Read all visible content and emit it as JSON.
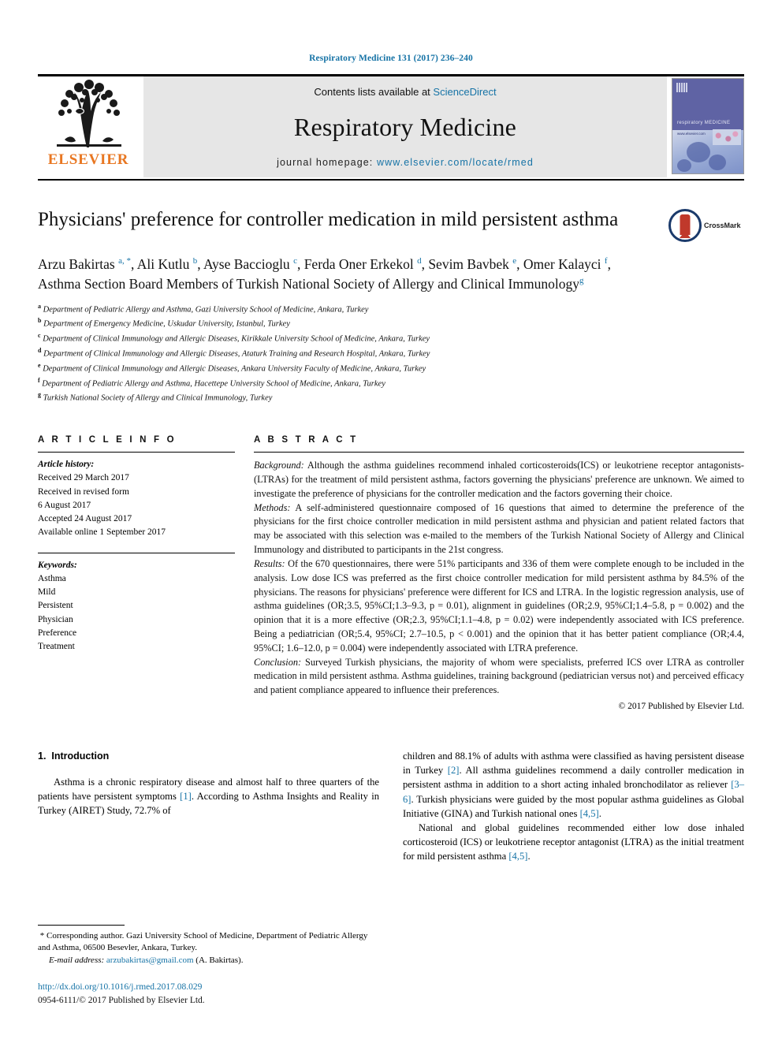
{
  "header": {
    "running_head": "Respiratory Medicine 131 (2017) 236–240",
    "contents_prefix": "Contents lists available at ",
    "contents_link": "ScienceDirect",
    "journal_name": "Respiratory Medicine",
    "homepage_prefix": "journal homepage: ",
    "homepage_url": "www.elsevier.com/locate/rmed",
    "publisher_logo_text": "ELSEVIER",
    "cover_title": "respiratory MEDICINE",
    "cover_url": "www.elsevier.com",
    "link_color": "#1673a6",
    "elsevier_orange": "#e87722"
  },
  "article": {
    "title": "Physicians' preference for controller medication in mild persistent asthma",
    "crossmark_label": "CrossMark",
    "authors_html": "Arzu Bakirtas <sup>a, *</sup>, Ali Kutlu <sup>b</sup>, Ayse Baccioglu <sup>c</sup>, Ferda Oner Erkekol <sup>d</sup>, Sevim Bavbek <sup>e</sup>, Omer Kalayci <sup>f</sup>, Asthma Section Board Members of Turkish National Society of Allergy and Clinical Immunology<sup>g</sup>",
    "affiliations": [
      {
        "marker": "a",
        "text": "Department of Pediatric Allergy and Asthma, Gazi University School of Medicine, Ankara, Turkey"
      },
      {
        "marker": "b",
        "text": "Department of Emergency Medicine, Uskudar University, Istanbul, Turkey"
      },
      {
        "marker": "c",
        "text": "Department of Clinical Immunology and Allergic Diseases, Kirikkale University School of Medicine, Ankara, Turkey"
      },
      {
        "marker": "d",
        "text": "Department of Clinical Immunology and Allergic Diseases, Ataturk Training and Research Hospital, Ankara, Turkey"
      },
      {
        "marker": "e",
        "text": "Department of Clinical Immunology and Allergic Diseases, Ankara University Faculty of Medicine, Ankara, Turkey"
      },
      {
        "marker": "f",
        "text": "Department of Pediatric Allergy and Asthma, Hacettepe University School of Medicine, Ankara, Turkey"
      },
      {
        "marker": "g",
        "text": "Turkish National Society of Allergy and Clinical Immunology, Turkey"
      }
    ]
  },
  "article_info": {
    "heading": "A R T I C L E   I N F O",
    "history_label": "Article history:",
    "history_lines": [
      "Received 29 March 2017",
      "Received in revised form",
      "6 August 2017",
      "Accepted 24 August 2017",
      "Available online 1 September 2017"
    ],
    "keywords_label": "Keywords:",
    "keywords": [
      "Asthma",
      "Mild",
      "Persistent",
      "Physician",
      "Preference",
      "Treatment"
    ]
  },
  "abstract": {
    "heading": "A B S T R A C T",
    "sections": [
      {
        "label": "Background:",
        "text": " Although the asthma guidelines recommend inhaled corticosteroids(ICS) or leukotriene receptor antagonists-(LTRAs) for the treatment of mild persistent asthma, factors governing the physicians' preference are unknown. We aimed to investigate the preference of physicians for the controller medication and the factors governing their choice."
      },
      {
        "label": "Methods:",
        "text": " A self-administered questionnaire composed of 16 questions that aimed to determine the preference of the physicians for the first choice controller medication in mild persistent asthma and physician and patient related factors that may be associated with this selection was e-mailed to the members of the Turkish National Society of Allergy and Clinical Immunology and distributed to participants in the 21st congress."
      },
      {
        "label": "Results:",
        "text": " Of the 670 questionnaires, there were 51% participants and 336 of them were complete enough to be included in the analysis. Low dose ICS was preferred as the first choice controller medication for mild persistent asthma by 84.5% of the physicians. The reasons for physicians' preference were different for ICS and LTRA. In the logistic regression analysis, use of asthma guidelines (OR;3.5, 95%CI;1.3–9.3, p = 0.01), alignment in guidelines (OR;2.9, 95%CI;1.4–5.8, p = 0.002) and the opinion that it is a more effective (OR;2.3, 95%CI;1.1–4.8, p = 0.02) were independently associated with ICS preference. Being a pediatrician (OR;5.4, 95%CI; 2.7–10.5, p < 0.001) and the opinion that it has better patient compliance (OR;4.4, 95%CI; 1.6–12.0, p = 0.004) were independently associated with LTRA preference."
      },
      {
        "label": "Conclusion:",
        "text": " Surveyed Turkish physicians, the majority of whom were specialists, preferred ICS over LTRA as controller medication in mild persistent asthma. Asthma guidelines, training background (pediatrician versus not) and perceived efficacy and patient compliance appeared to influence their preferences."
      }
    ],
    "copyright": "© 2017 Published by Elsevier Ltd."
  },
  "body": {
    "section_number": "1.",
    "section_title": "Introduction",
    "left_paragraph_pre": "Asthma is a chronic respiratory disease and almost half to three quarters of the patients have persistent symptoms ",
    "left_ref_1": "[1]",
    "left_paragraph_post": ". According to Asthma Insights and Reality in Turkey (AIRET) Study, 72.7% of",
    "right_p1_a": "children and 88.1% of adults with asthma were classified as having persistent disease in Turkey ",
    "right_ref_2": "[2]",
    "right_p1_b": ". All asthma guidelines recommend a daily controller medication in persistent asthma in addition to a short acting inhaled bronchodilator as reliever ",
    "right_ref_36": "[3–6]",
    "right_p1_c": ". Turkish physicians were guided by the most popular asthma guidelines as Global Initiative (GINA) and Turkish national ones ",
    "right_ref_45a": "[4,5]",
    "right_p1_d": ".",
    "right_p2_a": "National and global guidelines recommended either low dose inhaled corticosteroid (ICS) or leukotriene receptor antagonist (LTRA) as the initial treatment for mild persistent asthma ",
    "right_ref_45b": "[4,5]",
    "right_p2_b": "."
  },
  "footnote": {
    "corresponding_marker": "*",
    "corresponding_text": " Corresponding author. Gazi University School of Medicine, Department of Pediatric Allergy and Asthma, 06500 Besevler, Ankara, Turkey.",
    "email_label": "E-mail address:",
    "email_link": "arzubakirtas@gmail.com",
    "email_suffix": " (A. Bakirtas).",
    "doi": "http://dx.doi.org/10.1016/j.rmed.2017.08.029",
    "issn": "0954-6111/© 2017 Published by Elsevier Ltd."
  }
}
